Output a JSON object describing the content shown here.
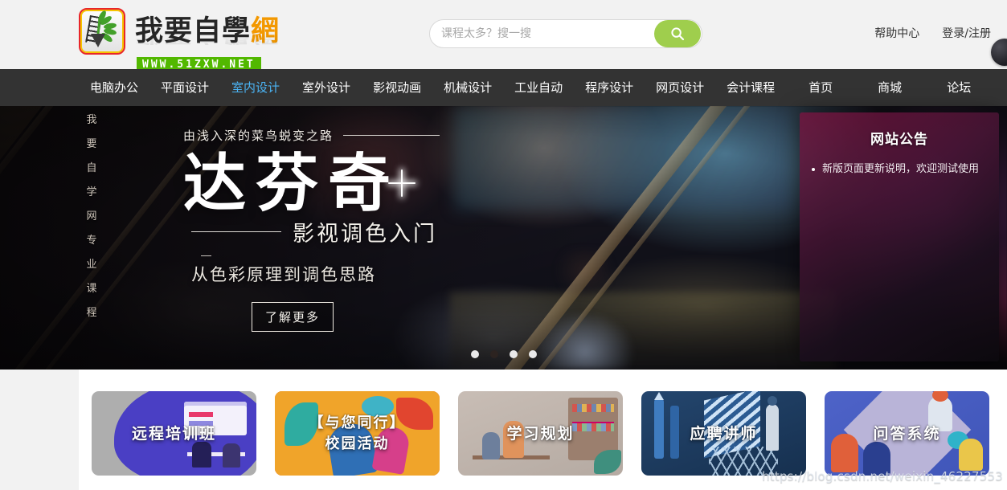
{
  "site": {
    "logo_cn": "我要自學",
    "logo_at": "網",
    "logo_url": "WWW.51ZXW.NET"
  },
  "search": {
    "placeholder": "课程太多？搜一搜",
    "value": "",
    "button_icon": "search-icon"
  },
  "top_links": [
    {
      "label": "帮助中心"
    },
    {
      "label": "登录/注册"
    }
  ],
  "nav": {
    "left_items": [
      {
        "label": "电脑办公",
        "active": false
      },
      {
        "label": "平面设计",
        "active": false
      },
      {
        "label": "室内设计",
        "active": true
      },
      {
        "label": "室外设计",
        "active": false
      },
      {
        "label": "影视动画",
        "active": false
      },
      {
        "label": "机械设计",
        "active": false
      },
      {
        "label": "工业自动",
        "active": false
      },
      {
        "label": "程序设计",
        "active": false
      },
      {
        "label": "网页设计",
        "active": false
      },
      {
        "label": "会计课程",
        "active": false
      }
    ],
    "right_items": [
      {
        "label": "首页"
      },
      {
        "label": "商城"
      },
      {
        "label": "论坛"
      }
    ],
    "active_color": "#4bb4f5",
    "bar_color": "#333333"
  },
  "vertical_strip": {
    "chars": [
      "我",
      "要",
      "自",
      "学",
      "网",
      "专",
      "业",
      "课",
      "程"
    ]
  },
  "hero": {
    "kicker": "由浅入深的菜鸟蜕变之路",
    "title": "达芬奇",
    "subtitle": "影视调色入门",
    "tagline": "从色彩原理到调色思路",
    "cta_label": "了解更多",
    "dots": [
      {
        "active": false
      },
      {
        "active": true
      },
      {
        "active": false
      },
      {
        "active": false
      }
    ]
  },
  "announcement": {
    "title": "网站公告",
    "items": [
      {
        "text": "新版页面更新说明，欢迎测试使用"
      }
    ]
  },
  "cards": [
    {
      "label": "远程培训班",
      "lines": 1,
      "art": "remote-training"
    },
    {
      "label": "【与您同行】\n校园活动",
      "line1": "【与您同行】",
      "line2": "校园活动",
      "lines": 2,
      "art": "campus-activity"
    },
    {
      "label": "学习规划",
      "lines": 1,
      "art": "study-planning"
    },
    {
      "label": "应聘讲师",
      "lines": 1,
      "art": "recruit-instructor"
    },
    {
      "label": "问答系统",
      "lines": 1,
      "art": "qa-system"
    }
  ],
  "watermark": {
    "text": "https://blog.csdn.net/weixin_46227553"
  }
}
